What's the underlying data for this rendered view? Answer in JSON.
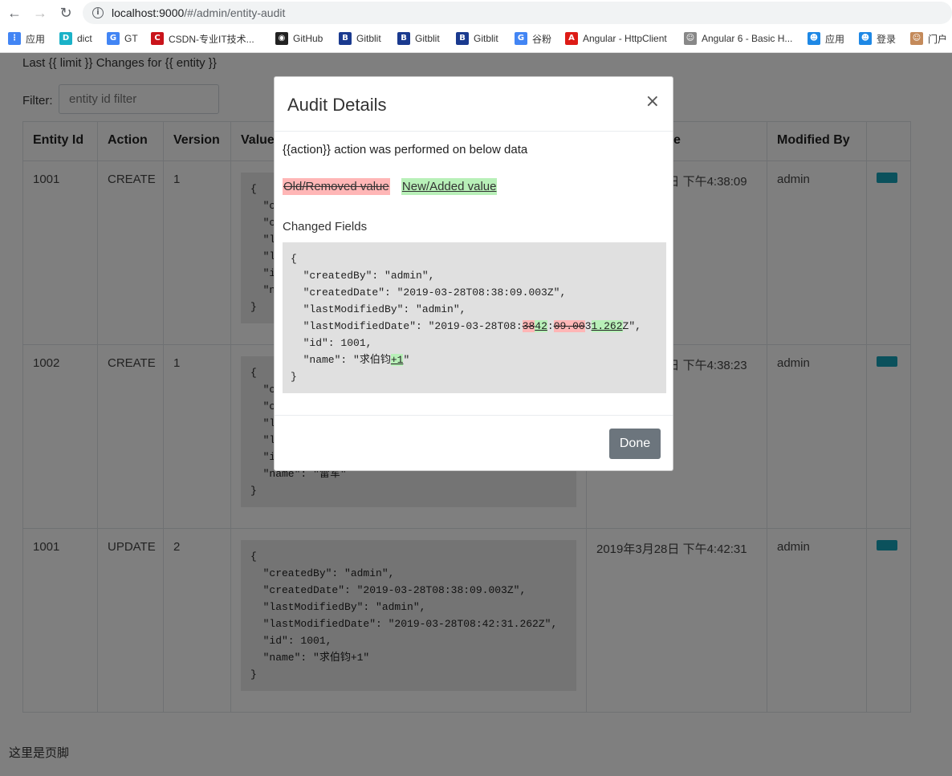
{
  "browser": {
    "url_host": "localhost:9000",
    "url_path": "/#/admin/entity-audit",
    "bookmarks": [
      {
        "label": "应用",
        "icon": "apps-grid-icon",
        "color": "#4285f4"
      },
      {
        "label": "dict",
        "icon": "dict-icon",
        "color": "#1ab2c8"
      },
      {
        "label": "GT",
        "icon": "translate-icon",
        "color": "#4285f4"
      },
      {
        "label": "CSDN-专业IT技术...",
        "icon": "csdn-icon",
        "color": "#c9141b"
      },
      {
        "label": "GitHub",
        "icon": "github-icon",
        "color": "#222222"
      },
      {
        "label": "Gitblit",
        "icon": "gitblit-icon",
        "color": "#1a3a8f"
      },
      {
        "label": "Gitblit",
        "icon": "gitblit-icon",
        "color": "#1a3a8f"
      },
      {
        "label": "Gitblit",
        "icon": "gitblit-icon",
        "color": "#1a3a8f"
      },
      {
        "label": "谷粉",
        "icon": "google-icon",
        "color": "#4285f4"
      },
      {
        "label": "Angular - HttpClient",
        "icon": "angular-icon",
        "color": "#dd1b16"
      },
      {
        "label": "Angular 6 - Basic H...",
        "icon": "person-icon",
        "color": "#888888"
      },
      {
        "label": "应用",
        "icon": "qq-icon",
        "color": "#1e88e5"
      },
      {
        "label": "登录",
        "icon": "qq-icon",
        "color": "#1e88e5"
      },
      {
        "label": "门户",
        "icon": "avatar-icon",
        "color": "#c48a5a"
      }
    ]
  },
  "page": {
    "heading": "Last {{ limit }} Changes for {{ entity }}",
    "filter_label": "Filter:",
    "filter_placeholder": "entity id filter",
    "columns": [
      "Entity Id",
      "Action",
      "Version",
      "Value",
      "Modified Date",
      "Modified By",
      ""
    ],
    "rows": [
      {
        "entity_id": "1001",
        "action": "CREATE",
        "version": "1",
        "value": "{\n  \"createdBy\": \"admin\",\n  \"createdDate\": \"2019-03-28T08:38:09.003Z\",\n  \"lastModifiedBy\": \"admin\",\n  \"lastModifiedDate\": \"2019-03-28T08:38:09.003Z\",\n  \"id\": 1001,\n  \"name\": \"求伯钧\"\n}",
        "modified_date": "2019年3月28日 下午4:38:09",
        "modified_by": "admin"
      },
      {
        "entity_id": "1002",
        "action": "CREATE",
        "version": "1",
        "value": "{\n  \"createdBy\": \"admin\",\n  \"createdDate\": \"2019-03-28T08:38:23.120Z\",\n  \"lastModifiedBy\": \"admin\",\n  \"lastModifiedDate\": \"2019-03-28T08:38:23.120Z\",\n  \"id\": 1002,\n  \"name\": \"雷军\"\n}",
        "modified_date": "2019年3月28日 下午4:38:23",
        "modified_by": "admin"
      },
      {
        "entity_id": "1001",
        "action": "UPDATE",
        "version": "2",
        "value": "{\n  \"createdBy\": \"admin\",\n  \"createdDate\": \"2019-03-28T08:38:09.003Z\",\n  \"lastModifiedBy\": \"admin\",\n  \"lastModifiedDate\": \"2019-03-28T08:42:31.262Z\",\n  \"id\": 1001,\n  \"name\": \"求伯钧+1\"\n}",
        "modified_date": "2019年3月28日 下午4:42:31",
        "modified_by": "admin"
      }
    ],
    "footer": "这里是页脚"
  },
  "modal": {
    "title": "Audit Details",
    "close_symbol": "×",
    "action_text": "{{action}} action was performed on below data",
    "legend_old": "Old/Removed value",
    "legend_new": "New/Added value",
    "changed_label": "Changed Fields",
    "diff": {
      "open": "{",
      "created_by": "  \"createdBy\": \"admin\",",
      "created_date": "  \"createdDate\": \"2019-03-28T08:38:09.003Z\",",
      "last_modified_by": "  \"lastModifiedBy\": \"admin\",",
      "lmd_prefix": "  \"lastModifiedDate\": \"2019-03-28T08:",
      "lmd_del1": "38",
      "lmd_ins1": "42",
      "lmd_colon": ":",
      "lmd_del2": "09.00",
      "lmd_mid": "3",
      "lmd_ins2": "1.262",
      "lmd_suffix": "Z\",",
      "id_line": "  \"id\": 1001,",
      "name_prefix": "  \"name\": \"求伯钧",
      "name_ins": "+1",
      "name_suffix": "\"",
      "close": "}"
    },
    "done_label": "Done"
  },
  "colors": {
    "view_button": "#17a2b8",
    "done_button": "#6c757d",
    "removed_bg": "#ffb6b6",
    "added_bg": "#b8f0b8"
  }
}
